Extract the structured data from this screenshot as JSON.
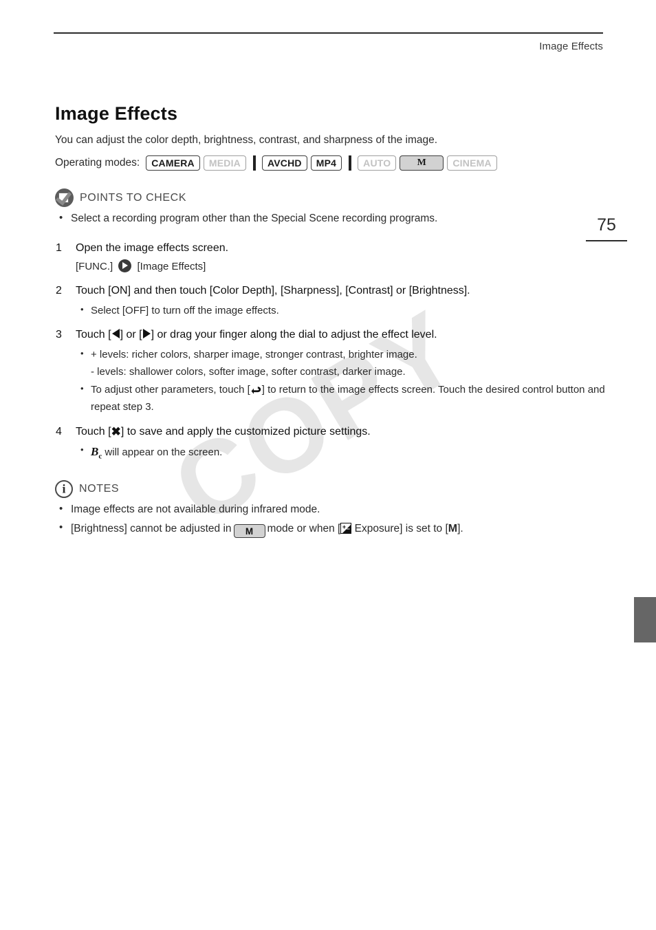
{
  "header": {
    "title": "Image Effects"
  },
  "page_number": "75",
  "watermark": "COPY",
  "doc": {
    "title": "Image Effects",
    "intro": "You can adjust the color depth, brightness, contrast, and sharpness of the image.",
    "operating_modes_label": "Operating modes:",
    "operating_modes": [
      {
        "label": "CAMERA",
        "state": "active"
      },
      {
        "label": "MEDIA",
        "state": "inactive"
      },
      {
        "separator": true
      },
      {
        "label": "AVCHD",
        "state": "active"
      },
      {
        "label": "MP4",
        "state": "active"
      },
      {
        "separator": true
      },
      {
        "label": "AUTO",
        "state": "inactive"
      },
      {
        "label": "M",
        "state": "selected"
      },
      {
        "label": "CINEMA",
        "state": "inactive"
      }
    ]
  },
  "points_to_check": {
    "label": "POINTS TO CHECK",
    "icon": "check-square-icon",
    "items": [
      "Select a recording program other than the Special Scene recording programs."
    ]
  },
  "steps": [
    {
      "number": "1",
      "text": "Open the image effects screen.",
      "path_prefix": "[FUNC.]",
      "path_icon": "func-arrow-icon",
      "path_suffix": "[Image Effects]"
    },
    {
      "number": "2",
      "text": "Touch [ON] and then touch [Color Depth], [Sharpness], [Contrast] or [Brightness].",
      "bullets": [
        "Select [OFF] to turn off the image effects."
      ]
    },
    {
      "number": "3",
      "text_a": "Touch [",
      "text_b": "] or [",
      "text_c": "] or drag your finger along the dial to adjust the effect level.",
      "bullets": [
        "+ levels: richer colors, sharper image, stronger contrast, brighter image.",
        "- levels: shallower colors, softer image, softer contrast, darker image."
      ],
      "bullet_back_a": "To adjust other parameters, touch [",
      "bullet_back_b": "] to return to the image effects screen. Touch the desired control button and repeat step 3."
    },
    {
      "number": "4",
      "text_a": "Touch [",
      "text_x": "✖",
      "text_b": "] to save and apply the customized picture settings.",
      "bullet_icon_main": "B",
      "bullet_icon_sub": "c",
      "bullet_tail": " will appear on the screen."
    }
  ],
  "notes": {
    "label": "NOTES",
    "icon": "info-circle-icon",
    "items": [
      {
        "text": "Image effects are not available during infrared mode."
      }
    ],
    "brightness_note": {
      "part_a": "[Brightness] cannot be adjusted in",
      "badge": "M",
      "part_b": "mode or when [",
      "exposure_label": "Exposure] is set to [",
      "m_value": "M",
      "part_c": "]."
    }
  },
  "colors": {
    "text": "#2b2b2b",
    "heading": "#111111",
    "badge_inactive": "#c2c2c2",
    "badge_fill": "#d2d2d2",
    "edge_tab": "#666666",
    "watermark": "#e6e6e6"
  }
}
